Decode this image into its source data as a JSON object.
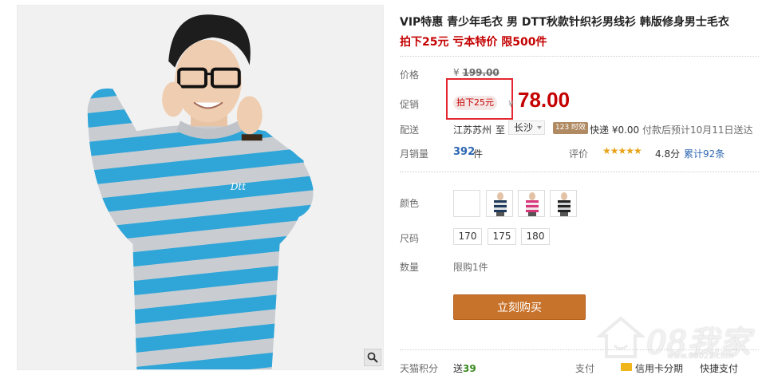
{
  "product": {
    "title": "VIP特惠 青少年毛衣 男 DTT秋款针织衫男线衫 韩版修身男士毛衣",
    "subtitle": "拍下25元 亏本特价 限500件",
    "price_label": "价格",
    "orig_price_yen": "¥",
    "orig_price": "199.00",
    "promo_label": "促销",
    "promo_tag": "拍下25元",
    "promo_yen": "¥",
    "promo_price": "78.00",
    "ship_label": "配送",
    "ship_from": "江苏苏州",
    "ship_to_word": "至",
    "ship_dest": "长沙",
    "time_badge": "123 时效",
    "ship_method": "快递 ¥0.00",
    "ship_eta": "付款后预计10月11日送达",
    "sales_label": "月销量",
    "sales_count": "392",
    "sales_unit": "件",
    "rating_label": "评价",
    "rating_stars": "★★★★★",
    "rating_score": "4.8分",
    "review_count": "累计92条",
    "color_label": "颜色",
    "size_label": "尺码",
    "sizes": [
      "170",
      "175",
      "180"
    ],
    "qty_label": "数量",
    "qty_limit": "限购1件",
    "buy_button": "立刻购买",
    "points_label": "天猫积分",
    "points_send": "送",
    "points_value": "39",
    "pay_label": "支付",
    "credit_installment": "信用卡分期",
    "express_pay": "快捷支付",
    "logo_text": "Dtt"
  },
  "watermark": {
    "main": "08我家",
    "sub": "www.08022.com"
  },
  "colors": {
    "accent_red": "#c40000",
    "buy_button": "#c8732c",
    "stripe_blue": "#2fa5d8",
    "stripe_gray": "#c9cdd2",
    "link_blue": "#2d67b1"
  }
}
